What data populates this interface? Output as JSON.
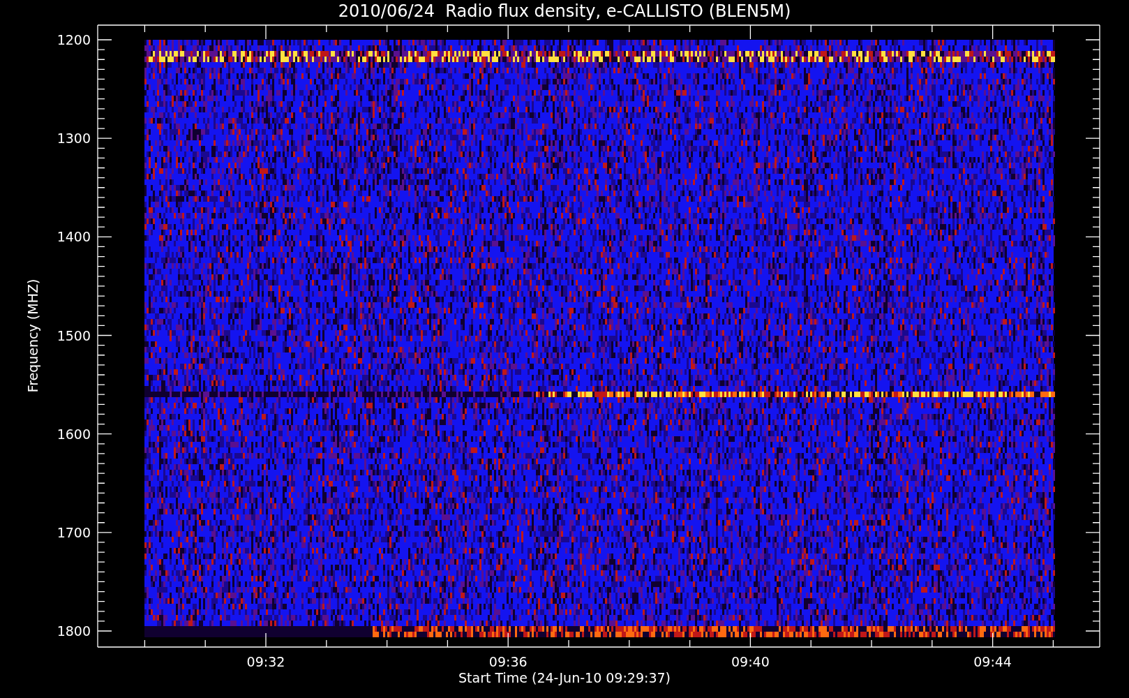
{
  "title": "2010/06/24  Radio flux density, e-CALLISTO (BLEN5M)",
  "ylabel": "Frequency (MHZ)",
  "xlabel": "Start Time (24-Jun-10 09:29:37)",
  "yticks": [
    "1200",
    "1300",
    "1400",
    "1500",
    "1600",
    "1700",
    "1800"
  ],
  "xticks": [
    "09:32",
    "09:36",
    "09:40",
    "09:44"
  ]
}
